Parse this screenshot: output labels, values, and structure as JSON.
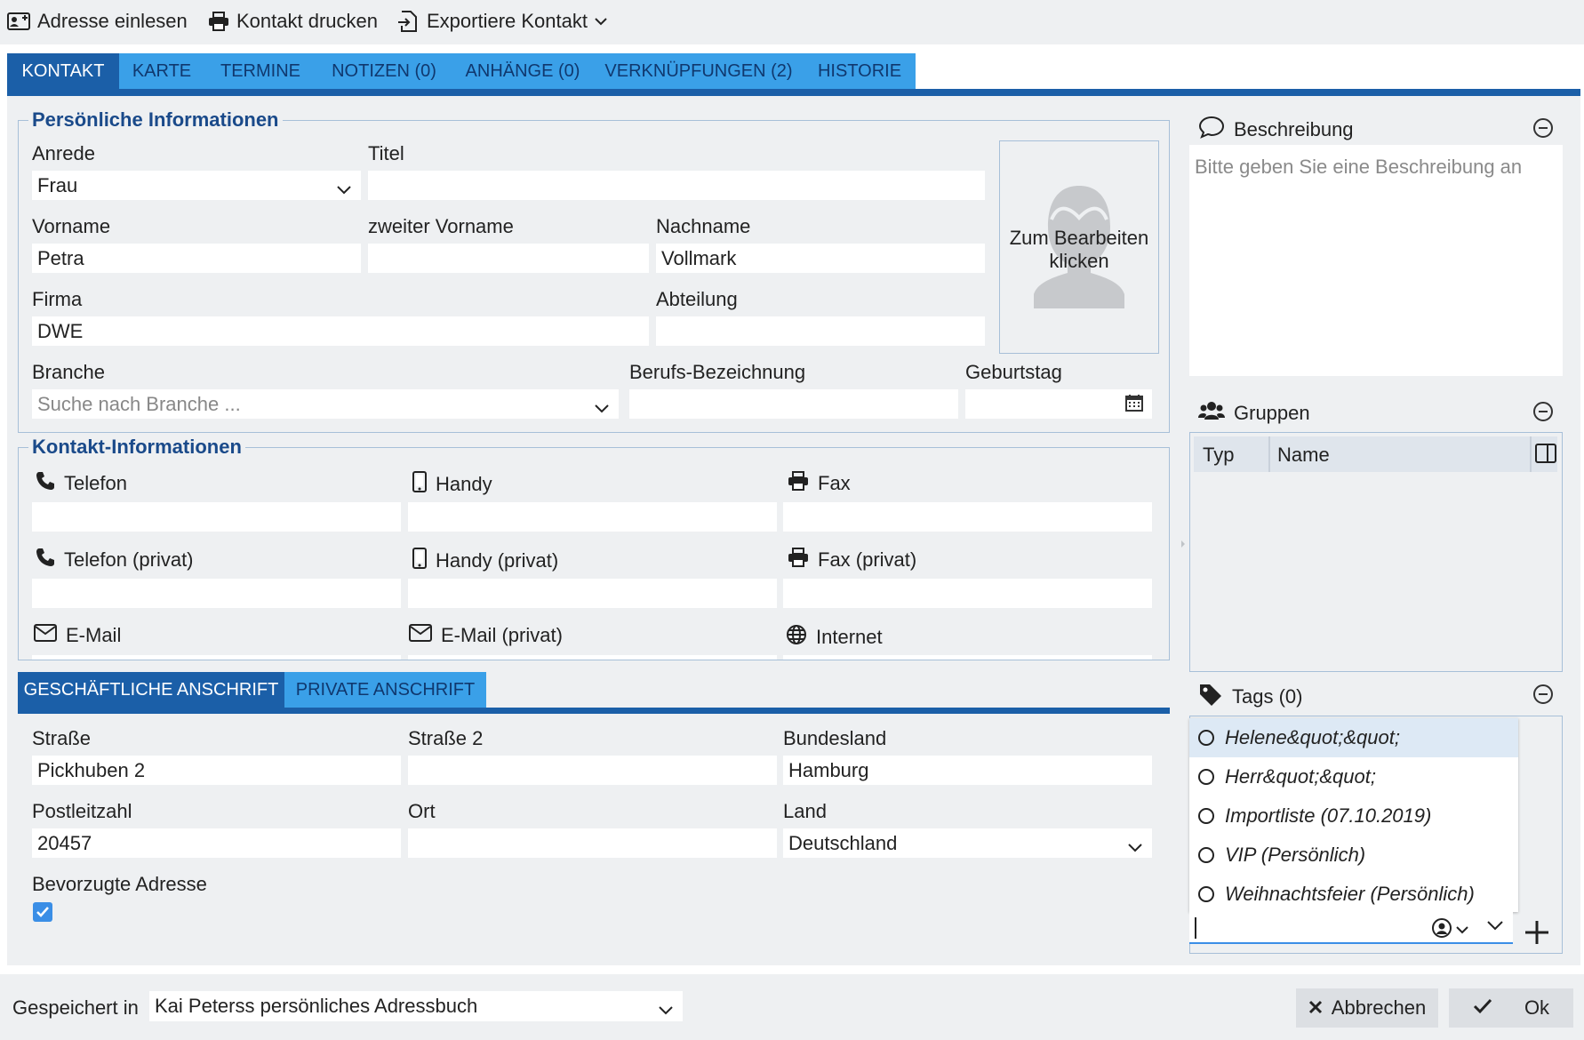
{
  "toolbar": {
    "read_address": "Adresse einlesen",
    "print_contact": "Kontakt drucken",
    "export_contact": "Exportiere Kontakt"
  },
  "tabs": [
    {
      "label": "KONTAKT"
    },
    {
      "label": "KARTE"
    },
    {
      "label": "TERMINE"
    },
    {
      "label": "NOTIZEN (0)"
    },
    {
      "label": "ANHÄNGE (0)"
    },
    {
      "label": "VERKNÜPFUNGEN (2)"
    },
    {
      "label": "HISTORIE"
    }
  ],
  "personal": {
    "legend": "Persönliche Informationen",
    "salutation_label": "Anrede",
    "salutation_value": "Frau",
    "title_label": "Titel",
    "title_value": "",
    "firstname_label": "Vorname",
    "firstname_value": "Petra",
    "middlename_label": "zweiter Vorname",
    "middlename_value": "",
    "lastname_label": "Nachname",
    "lastname_value": "Vollmark",
    "company_label": "Firma",
    "company_value": "DWE",
    "department_label": "Abteilung",
    "department_value": "",
    "industry_label": "Branche",
    "industry_placeholder": "Suche nach Branche ...",
    "job_label": "Berufs-Bezeichnung",
    "job_value": "",
    "birthday_label": "Geburtstag",
    "birthday_value": "",
    "photo_text": "Zum Bearbeiten klicken"
  },
  "contact_info": {
    "legend": "Kontakt-Informationen",
    "phone_label": "Telefon",
    "mobile_label": "Handy",
    "fax_label": "Fax",
    "phone_private_label": "Telefon (privat)",
    "mobile_private_label": "Handy (privat)",
    "fax_private_label": "Fax (privat)",
    "email_label": "E-Mail",
    "email_private_label": "E-Mail (privat)",
    "internet_label": "Internet"
  },
  "address": {
    "tabs": [
      {
        "label": "GESCHÄFTLICHE ANSCHRIFT"
      },
      {
        "label": "PRIVATE ANSCHRIFT"
      }
    ],
    "street_label": "Straße",
    "street_value": "Pickhuben 2",
    "street2_label": "Straße 2",
    "street2_value": "",
    "state_label": "Bundesland",
    "state_value": "Hamburg",
    "zip_label": "Postleitzahl",
    "zip_value": "20457",
    "city_label": "Ort",
    "city_value": "",
    "country_label": "Land",
    "country_value": "Deutschland",
    "preferred_label": "Bevorzugte Adresse",
    "preferred_checked": true
  },
  "description": {
    "title": "Beschreibung",
    "placeholder": "Bitte geben Sie eine Beschreibung an"
  },
  "groups": {
    "title": "Gruppen",
    "columns": [
      "Typ",
      "Name"
    ]
  },
  "tags": {
    "title": "Tags (0)",
    "options": [
      "Helene&quot;&quot;",
      "Herr&quot;&quot;",
      "Importliste (07.10.2019)",
      "VIP (Persönlich)",
      "Weihnachtsfeier (Persönlich)"
    ]
  },
  "footer": {
    "saved_in_label": "Gespeichert in",
    "saved_in_value": "Kai Peterss persönliches Adressbuch",
    "cancel_label": "Abbrechen",
    "ok_label": "Ok"
  },
  "colors": {
    "tab_bar": "#3aa0e8",
    "tab_active": "#1b5fa8",
    "legend_text": "#1a4a8a",
    "panel_bg": "#eef0f2"
  }
}
